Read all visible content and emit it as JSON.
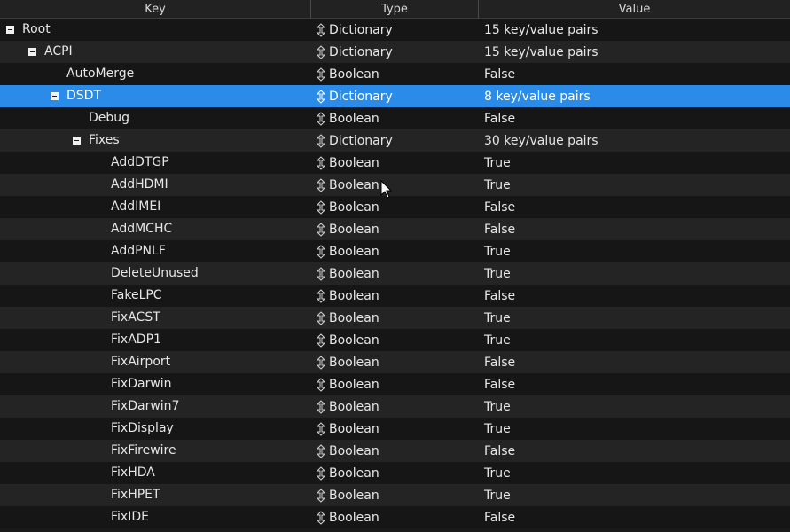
{
  "columns": {
    "key": "Key",
    "type": "Type",
    "value": "Value"
  },
  "rows": [
    {
      "key": "Root",
      "type": "Dictionary",
      "value": "15 key/value pairs",
      "depth": 0,
      "expandable": true,
      "selected": false
    },
    {
      "key": "ACPI",
      "type": "Dictionary",
      "value": "15 key/value pairs",
      "depth": 1,
      "expandable": true,
      "selected": false
    },
    {
      "key": "AutoMerge",
      "type": "Boolean",
      "value": "False",
      "depth": 2,
      "expandable": false,
      "selected": false
    },
    {
      "key": "DSDT",
      "type": "Dictionary",
      "value": "8 key/value pairs",
      "depth": 2,
      "expandable": true,
      "selected": true
    },
    {
      "key": "Debug",
      "type": "Boolean",
      "value": "False",
      "depth": 3,
      "expandable": false,
      "selected": false
    },
    {
      "key": "Fixes",
      "type": "Dictionary",
      "value": "30 key/value pairs",
      "depth": 3,
      "expandable": true,
      "selected": false
    },
    {
      "key": "AddDTGP",
      "type": "Boolean",
      "value": "True",
      "depth": 4,
      "expandable": false,
      "selected": false
    },
    {
      "key": "AddHDMI",
      "type": "Boolean",
      "value": "True",
      "depth": 4,
      "expandable": false,
      "selected": false
    },
    {
      "key": "AddIMEI",
      "type": "Boolean",
      "value": "False",
      "depth": 4,
      "expandable": false,
      "selected": false
    },
    {
      "key": "AddMCHC",
      "type": "Boolean",
      "value": "False",
      "depth": 4,
      "expandable": false,
      "selected": false
    },
    {
      "key": "AddPNLF",
      "type": "Boolean",
      "value": "True",
      "depth": 4,
      "expandable": false,
      "selected": false
    },
    {
      "key": "DeleteUnused",
      "type": "Boolean",
      "value": "True",
      "depth": 4,
      "expandable": false,
      "selected": false
    },
    {
      "key": "FakeLPC",
      "type": "Boolean",
      "value": "False",
      "depth": 4,
      "expandable": false,
      "selected": false
    },
    {
      "key": "FixACST",
      "type": "Boolean",
      "value": "True",
      "depth": 4,
      "expandable": false,
      "selected": false
    },
    {
      "key": "FixADP1",
      "type": "Boolean",
      "value": "True",
      "depth": 4,
      "expandable": false,
      "selected": false
    },
    {
      "key": "FixAirport",
      "type": "Boolean",
      "value": "False",
      "depth": 4,
      "expandable": false,
      "selected": false
    },
    {
      "key": "FixDarwin",
      "type": "Boolean",
      "value": "False",
      "depth": 4,
      "expandable": false,
      "selected": false
    },
    {
      "key": "FixDarwin7",
      "type": "Boolean",
      "value": "True",
      "depth": 4,
      "expandable": false,
      "selected": false
    },
    {
      "key": "FixDisplay",
      "type": "Boolean",
      "value": "True",
      "depth": 4,
      "expandable": false,
      "selected": false
    },
    {
      "key": "FixFirewire",
      "type": "Boolean",
      "value": "False",
      "depth": 4,
      "expandable": false,
      "selected": false
    },
    {
      "key": "FixHDA",
      "type": "Boolean",
      "value": "True",
      "depth": 4,
      "expandable": false,
      "selected": false
    },
    {
      "key": "FixHPET",
      "type": "Boolean",
      "value": "True",
      "depth": 4,
      "expandable": false,
      "selected": false
    },
    {
      "key": "FixIDE",
      "type": "Boolean",
      "value": "False",
      "depth": 4,
      "expandable": false,
      "selected": false
    }
  ],
  "colors": {
    "selection": "#2a8ce8",
    "background": "#1a1a1a",
    "row_alt": "#242424"
  },
  "icons": {
    "expand_toggle": "collapse-toggle-icon",
    "type_stepper": "up-down-stepper-icon",
    "pointer": "mouse-cursor-icon"
  }
}
